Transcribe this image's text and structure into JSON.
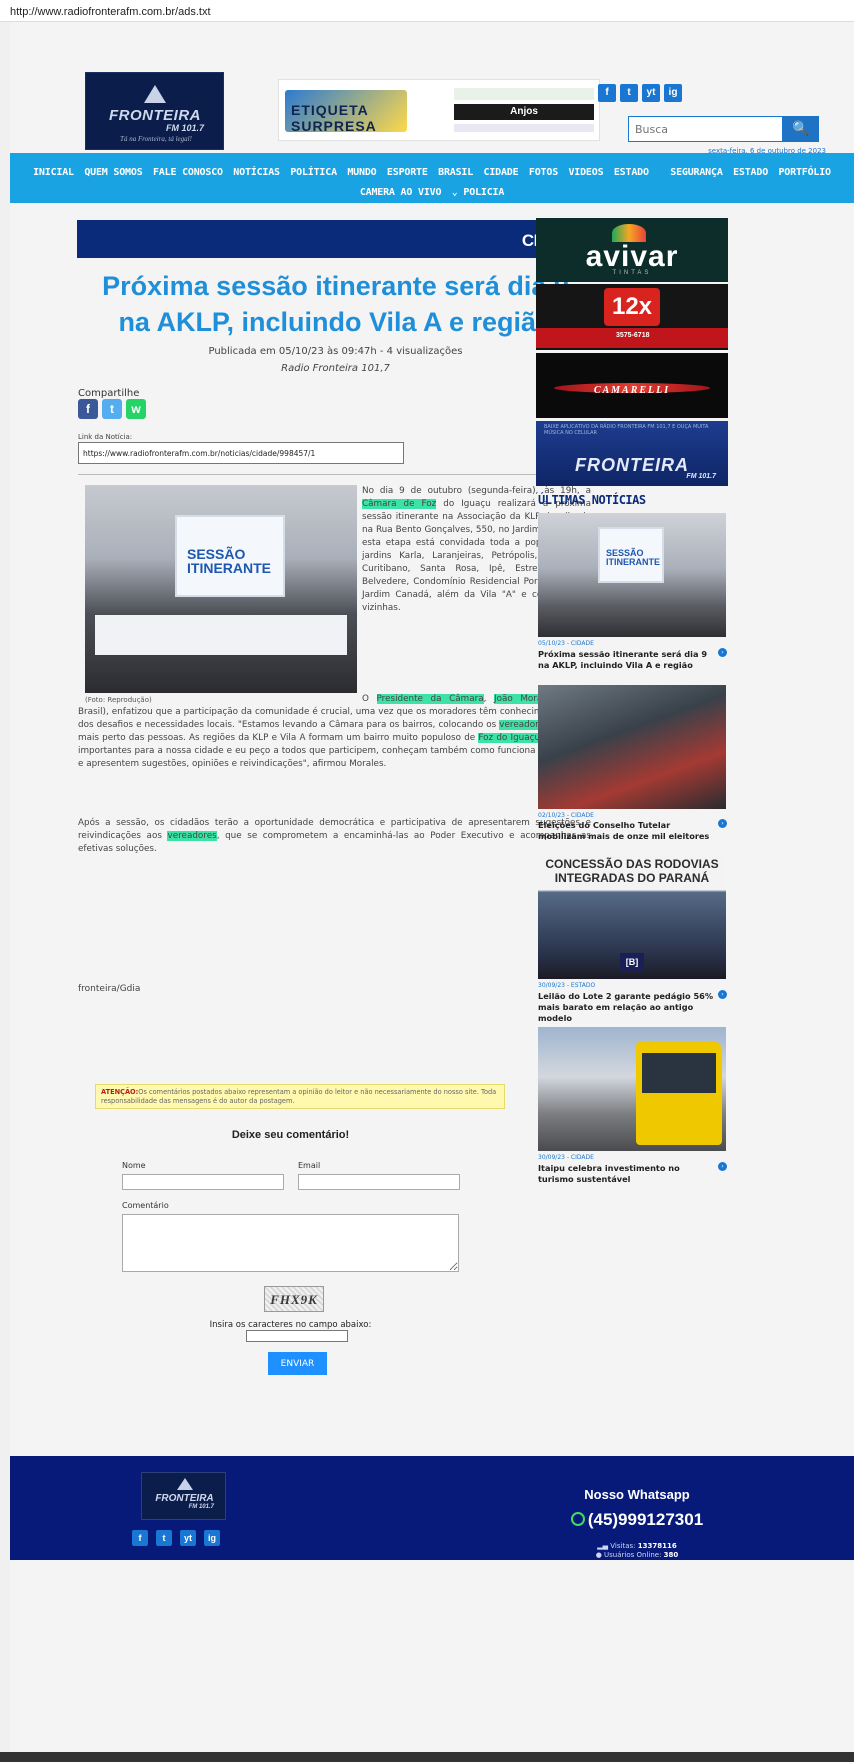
{
  "browser": {
    "url": "http://www.radiofronterafm.com.br/ads.txt"
  },
  "header": {
    "logo": {
      "name": "FRONTEIRA",
      "fm": "FM 101.7",
      "slogan": "Tá na Fronteira, tá legal!"
    },
    "banner": {
      "left_text": "ETIQUETA SURPRESA",
      "right_text": "Anjos"
    },
    "social": [
      "f",
      "t",
      "yt",
      "ig"
    ],
    "search_placeholder": "Busca",
    "search_button": "🔍",
    "date": "sexta-feira, 6 de outubro de 2023"
  },
  "nav": {
    "row1": [
      "INICIAL",
      "QUEM SOMOS",
      "FALE CONOSCO",
      "NOTÍCIAS",
      "POLÍTICA",
      "MUNDO",
      "ESPORTE",
      "BRASIL",
      "CIDADE",
      "FOTOS",
      "VIDEOS",
      "ESTADO",
      "SEGURANÇA",
      "ESTADO",
      "PORTFÓLIO"
    ],
    "row2": [
      "CAMERA AO VIVO",
      "POLICIA"
    ]
  },
  "article": {
    "category": "CIDADE",
    "title": "Próxima sessão itinerante será dia 9 na AKLP, incluindo Vila A e região",
    "published": "Publicada em 05/10/23 às 09:47h - 4 visualizações",
    "author": "Radio Fronteira 101,7",
    "share_label": "Compartilhe",
    "link_label": "Link da Notícia:",
    "link_value": "https://www.radiofronterafm.com.br/noticias/cidade/998457/1",
    "photo_text": "SESSÃO ITINERANTE",
    "photo_caption": "(Foto: Reprodução)",
    "p1_a": "No dia 9 de outubro (segunda-feira), às 19h, a ",
    "p1_hl1": "Câmara de Foz",
    "p1_b": " do Iguaçu realizará a próxima sessão itinerante na Associação da KLP, localizada na Rua Bento Gonçalves, 550, no Jardim Karla. Para esta etapa está convidada toda a população dos jardins Karla, Laranjeiras, Petrópolis, Lancaster, Curitibano, Santa Rosa, Ipê, Estrela, Paraná, Belvedere, Condomínio Residencial Porto Seguro e Jardim Canadá, além da Vila \"A\" e comunidades vizinhas.",
    "p2_a": "O ",
    "p2_hl1": "Presidente da Câmara",
    "p2_b": ", ",
    "p2_hl2": "João Morales",
    "p2_c": " (União Brasil), enfatizou que a participação da comunidade é crucial, uma vez que os moradores têm conhecimento direto dos desafios e necessidades locais. \"Estamos levando a Câmara para os bairros, colocando os ",
    "p2_hl3": "vereadores",
    "p2_d": " cada vez mais perto das pessoas. As regiões da KLP e Vila A formam um bairro muito populoso de ",
    "p2_hl4": "Foz do Iguaçu",
    "p2_e": ". São muito importantes para a nossa cidade e eu peço a todos que participem, conheçam também como funciona uma sessão e apresentem sugestões, opiniões e reivindicações\", afirmou Morales.",
    "p3_a": "Após a sessão, os cidadãos terão a oportunidade democrática e participativa de apresentarem sugestões e reivindicações aos ",
    "p3_hl1": "vereadores",
    "p3_b": ", que se comprometem a encaminhá-las ao Poder Executivo e acompanhar as efetivas soluções.",
    "signoff": "fronteira/Gdia"
  },
  "comments": {
    "warn_bold": "ATENÇÃO:",
    "warn_text": "Os comentários postados abaixo representam a opinião do leitor e não necessariamente do nosso site. Toda responsabilidade das mensagens é do autor da postagem.",
    "title": "Deixe seu comentário!",
    "name_label": "Nome",
    "email_label": "Email",
    "comment_label": "Comentário",
    "captcha_text": "FHX9K",
    "captcha_label": "Insira os caracteres no campo abaixo:",
    "send": "ENVIAR"
  },
  "sidebar": {
    "ads": {
      "avivar": "avivar",
      "avivar_sub": "TINTAS",
      "grafica_big": "12x",
      "grafica_tel": "3575-6718",
      "car": "CAMARELLI",
      "radio_small": "BAIXE APLICATIVO DA RÁDIO FRONTEIRA FM 101,7 E OUÇA MUITA MÚSICA NO CELULAR",
      "radio_name": "FRONTEIRA",
      "radio_fm": "FM 101.7"
    },
    "latest_title": "ÚLTIMAS NOTÍCIAS",
    "news": [
      {
        "meta": "05/10/23 - CIDADE",
        "title": "Próxima sessão itinerante será dia 9 na AKLP, incluindo Vila A e região"
      },
      {
        "meta": "02/10/23 - CIDADE",
        "title": "Eleições do Conselho Tutelar mobilizam mais de onze mil eleitores"
      },
      {
        "meta": "30/09/23 - ESTADO",
        "title": "Leilão do Lote 2 garante pedágio 56% mais barato em relação ao antigo modelo",
        "img_text": "CONCESSÃO DAS RODOVIAS INTEGRADAS DO PARANÁ",
        "img_badge": "[B]"
      },
      {
        "meta": "30/09/23 - CIDADE",
        "title": "Itaipu celebra investimento no turismo sustentável"
      }
    ]
  },
  "footer": {
    "whatsapp_title": "Nosso Whatsapp",
    "whatsapp_number": "(45)999127301",
    "visits_label": "Visitas: ",
    "visits_value": "13378116",
    "online_label": "Usuários Online: ",
    "online_value": "380"
  },
  "colors": {
    "nav": "#1aa3e3",
    "title": "#1e8fd8",
    "category_bar": "#0a2a7a",
    "highlight": "#3de3a6",
    "footer": "#071a7a"
  }
}
